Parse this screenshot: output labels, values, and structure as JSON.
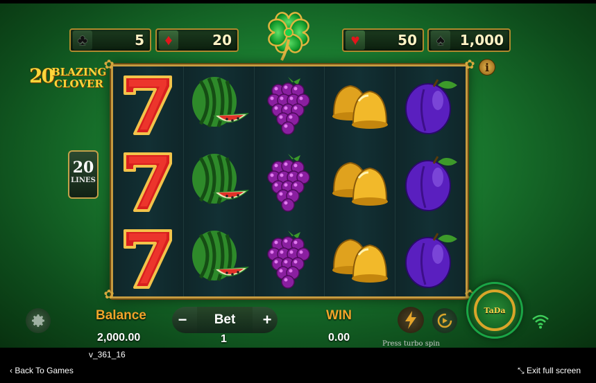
{
  "jackpots": [
    {
      "suit": "club",
      "icon": "club-icon",
      "glyph": "♣",
      "value": "5"
    },
    {
      "suit": "diamond",
      "icon": "diamond-icon",
      "glyph": "♦",
      "value": "20"
    },
    {
      "suit": "heart",
      "icon": "heart-icon",
      "glyph": "♥",
      "value": "50"
    },
    {
      "suit": "spade",
      "icon": "spade-icon",
      "glyph": "♠",
      "value": "1,000"
    }
  ],
  "logo": {
    "number": "20",
    "line1": "BLAZING",
    "line2": "CLOVER"
  },
  "lines": {
    "count": "20",
    "label": "LINES"
  },
  "info_label": "i",
  "reels": [
    [
      "seven",
      "seven",
      "seven"
    ],
    [
      "watermelon",
      "watermelon",
      "watermelon"
    ],
    [
      "grapes",
      "grapes",
      "grapes"
    ],
    [
      "bells",
      "bells",
      "bells"
    ],
    [
      "plum",
      "plum",
      "plum"
    ]
  ],
  "controls": {
    "balance_label": "Balance",
    "balance_value": "2,000.00",
    "bet_label": "Bet",
    "bet_minus": "−",
    "bet_plus": "+",
    "bet_value": "1",
    "win_label": "WIN",
    "win_value": "0.00",
    "turbo_label": "Press turbo spin",
    "spin_label": "TaDa"
  },
  "footer": {
    "version": "v_361_16",
    "back": "Back To Games",
    "exit": "Exit full screen"
  },
  "colors": {
    "accent_gold": "#f0a52a",
    "reel_bg": "#0c1f23",
    "frame": "#c59a3f"
  }
}
